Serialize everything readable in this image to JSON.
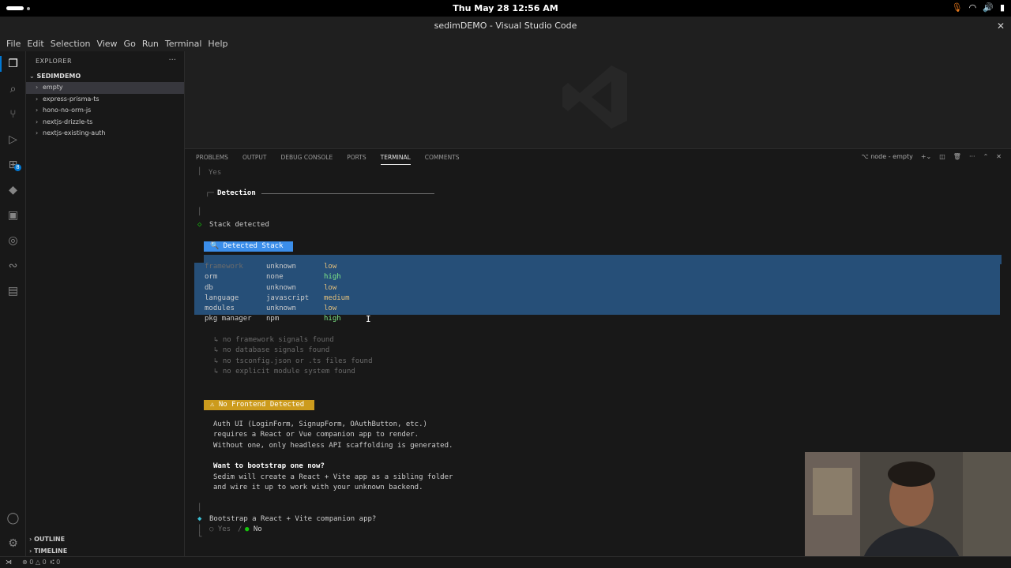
{
  "system": {
    "clock": "Thu May 28  12:56 AM"
  },
  "window": {
    "title": "sedimDEMO - Visual Studio Code"
  },
  "menu": [
    "File",
    "Edit",
    "Selection",
    "View",
    "Go",
    "Run",
    "Terminal",
    "Help"
  ],
  "explorer": {
    "header": "EXPLORER",
    "root": "SEDIMDEMO",
    "items": [
      {
        "label": "empty",
        "selected": true
      },
      {
        "label": "express-prisma-ts",
        "selected": false
      },
      {
        "label": "hono-no-orm-js",
        "selected": false
      },
      {
        "label": "nextjs-drizzle-ts",
        "selected": false
      },
      {
        "label": "nextjs-existing-auth",
        "selected": false
      }
    ],
    "outline": "OUTLINE",
    "timeline": "TIMELINE"
  },
  "panel": {
    "tabs": [
      "PROBLEMS",
      "OUTPUT",
      "DEBUG CONSOLE",
      "PORTS",
      "TERMINAL",
      "COMMENTS"
    ],
    "active_tab": "TERMINAL",
    "terminal_name": "node - empty"
  },
  "terminal": {
    "yes_prev": "Yes",
    "detection_title": "Detection",
    "stack_detected": "Stack detected",
    "detected_stack_label": "🔍  Detected Stack",
    "rows": [
      {
        "key": "framework",
        "value": "unknown",
        "confidence": "low"
      },
      {
        "key": "orm",
        "value": "none",
        "confidence": "high"
      },
      {
        "key": "db",
        "value": "unknown",
        "confidence": "low"
      },
      {
        "key": "language",
        "value": "javascript",
        "confidence": "medium"
      },
      {
        "key": "modules",
        "value": "unknown",
        "confidence": "low"
      },
      {
        "key": "pkg manager",
        "value": "npm",
        "confidence": "high"
      }
    ],
    "notes": [
      "↳ no framework signals found",
      "↳ no database signals found",
      "↳ no tsconfig.json or .ts files found",
      "↳ no explicit module system found"
    ],
    "no_frontend_label": "⚠  No Frontend Detected",
    "auth_lines": [
      "Auth UI (LoginForm, SignupForm, OAuthButton, etc.)",
      "requires a React or Vue companion app to render.",
      "Without one, only headless API scaffolding is generated."
    ],
    "bootstrap_heading": "Want to bootstrap one now?",
    "bootstrap_lines": [
      "Sedim will create a React + Vite app as a sibling folder",
      "and wire it up to work with your unknown backend."
    ],
    "prompt_question": "Bootstrap a React + Vite companion app?",
    "prompt_yes": "Yes",
    "prompt_sep": "/",
    "prompt_no": "No"
  },
  "statusbar": {
    "errors": "0",
    "warnings": "0",
    "ports": "0"
  }
}
